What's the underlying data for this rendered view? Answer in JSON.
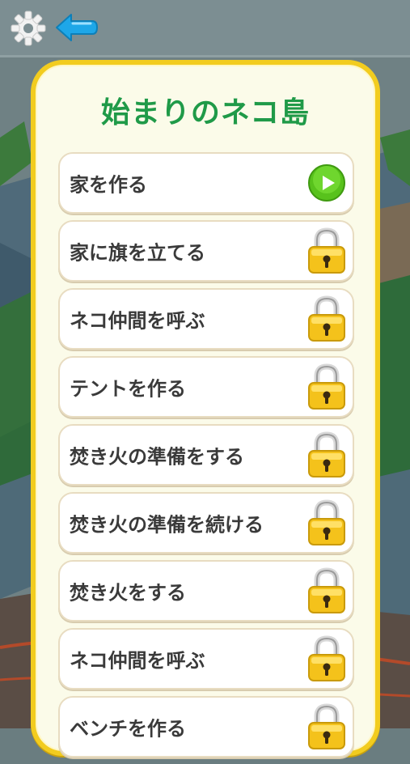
{
  "header": {
    "settings_icon": "gear-icon",
    "back_icon": "back-arrow-icon"
  },
  "panel": {
    "title": "始まりのネコ島"
  },
  "stages": [
    {
      "label": "家を作る",
      "state": "unlocked",
      "icon": "play-icon"
    },
    {
      "label": "家に旗を立てる",
      "state": "locked",
      "icon": "lock-icon"
    },
    {
      "label": "ネコ仲間を呼ぶ",
      "state": "locked",
      "icon": "lock-icon"
    },
    {
      "label": "テントを作る",
      "state": "locked",
      "icon": "lock-icon"
    },
    {
      "label": "焚き火の準備をする",
      "state": "locked",
      "icon": "lock-icon"
    },
    {
      "label": "焚き火の準備を続ける",
      "state": "locked",
      "icon": "lock-icon"
    },
    {
      "label": "焚き火をする",
      "state": "locked",
      "icon": "lock-icon"
    },
    {
      "label": "ネコ仲間を呼ぶ",
      "state": "locked",
      "icon": "lock-icon"
    },
    {
      "label": "ベンチを作る",
      "state": "locked",
      "icon": "lock-icon"
    }
  ],
  "colors": {
    "title": "#1f9a48",
    "panel_border": "#f2cc1f",
    "play": "#58c21c",
    "lock": "#f4c21b"
  }
}
